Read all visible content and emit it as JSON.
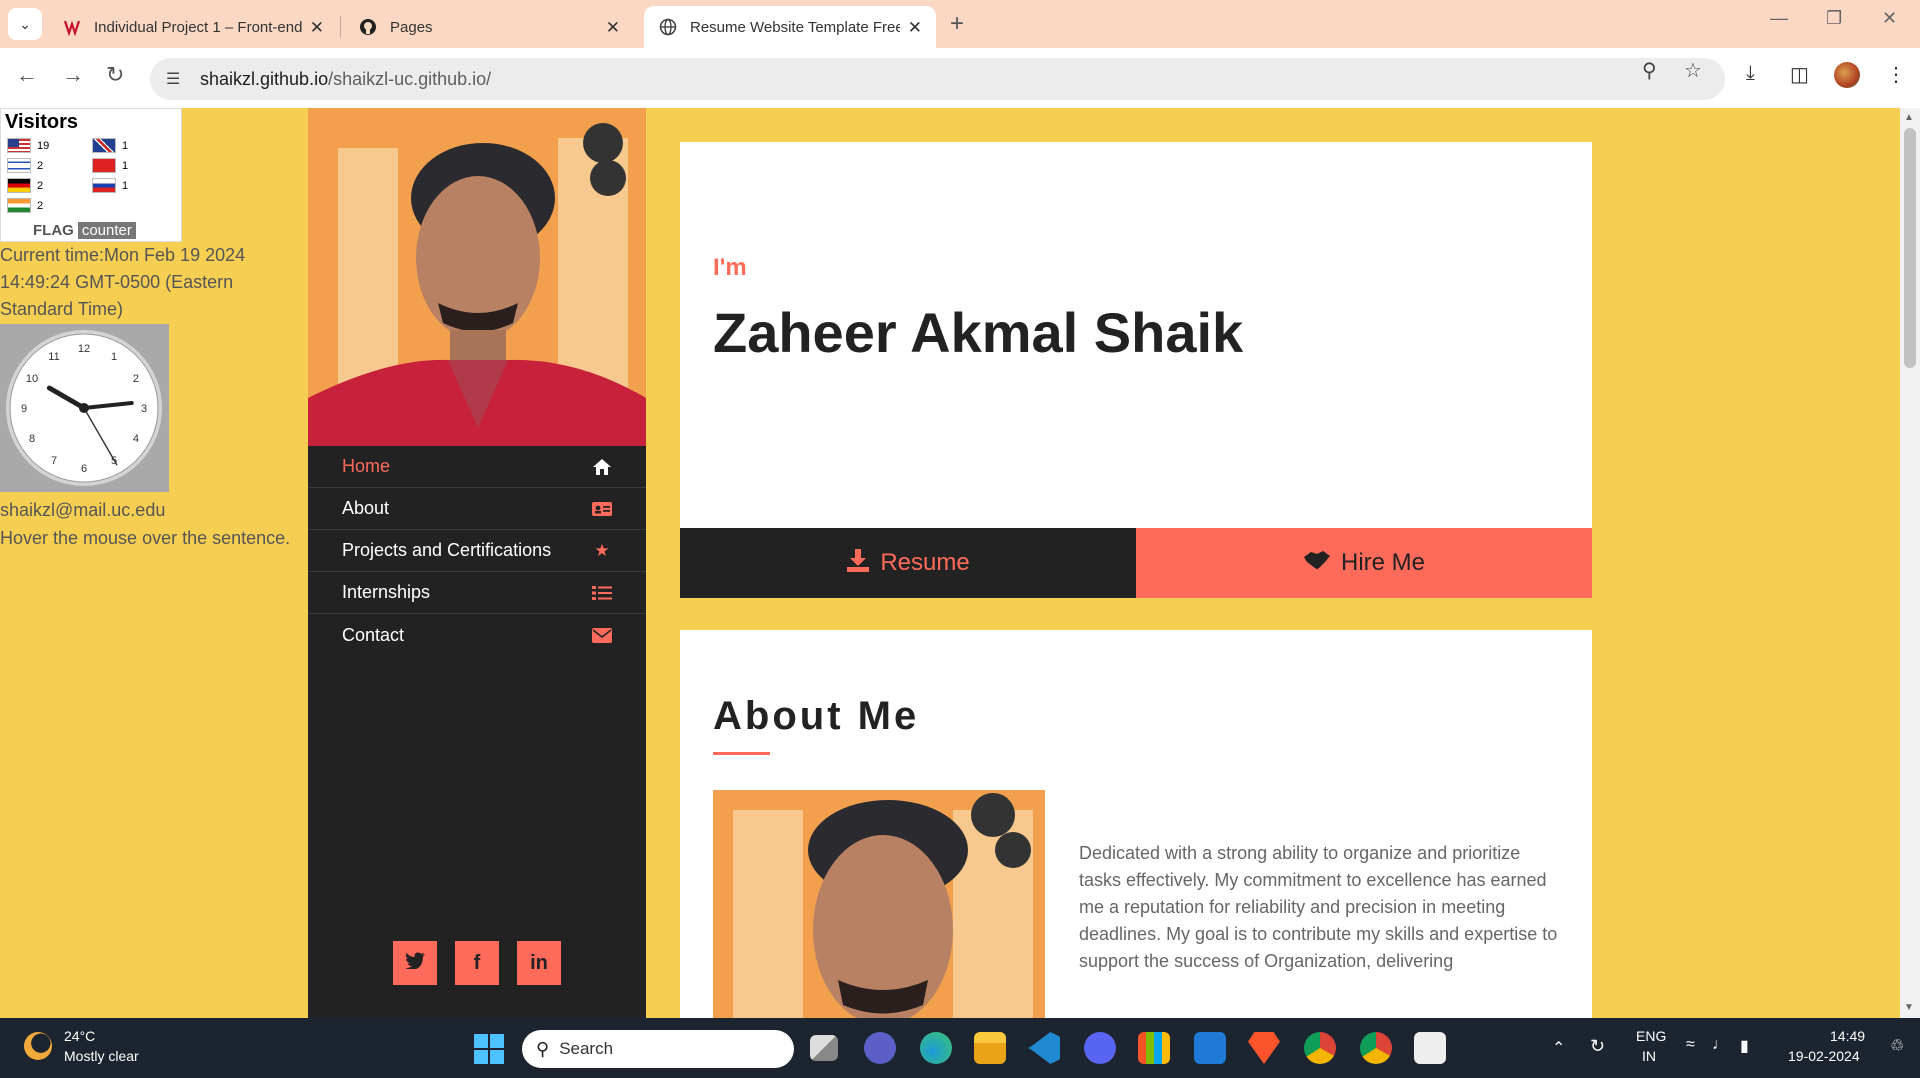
{
  "browser": {
    "tabs": [
      {
        "title": "Individual Project 1 – Front-end",
        "icon": "canvas-icon"
      },
      {
        "title": "Pages",
        "icon": "github-icon"
      },
      {
        "title": "Resume Website Template Free",
        "icon": "globe-icon"
      }
    ],
    "url_host": "shaikzl.github.io",
    "url_path": "/shaikzl-uc.github.io/"
  },
  "flag_counter": {
    "title": "Visitors",
    "rows": [
      {
        "country": "us",
        "count": "19"
      },
      {
        "country": "gb",
        "count": "1"
      },
      {
        "country": "il",
        "count": "2"
      },
      {
        "country": "hk",
        "count": "1"
      },
      {
        "country": "de",
        "count": "2"
      },
      {
        "country": "ru",
        "count": "1"
      },
      {
        "country": "in",
        "count": "2"
      }
    ],
    "logo_text": "FLAG",
    "logo_counter": "counter"
  },
  "sidebar_info": {
    "current_time": "Current time:Mon Feb 19 2024 14:49:24 GMT-0500 (Eastern Standard Time)",
    "clock_numbers": [
      "12",
      "1",
      "2",
      "3",
      "4",
      "5",
      "6",
      "7",
      "8",
      "9",
      "10",
      "11"
    ],
    "clock_time": {
      "hours": 2,
      "minutes": 49,
      "seconds": 24
    },
    "email": "shaikzl@mail.uc.edu",
    "hover_note": "Hover the mouse over the sentence."
  },
  "nav": {
    "items": [
      {
        "label": "Home",
        "icon": "home-icon",
        "active": true
      },
      {
        "label": "About",
        "icon": "id-card-icon"
      },
      {
        "label": "Projects and Certifications",
        "icon": "star-icon"
      },
      {
        "label": "Internships",
        "icon": "list-icon"
      },
      {
        "label": "Contact",
        "icon": "envelope-icon"
      }
    ],
    "social": [
      {
        "label": "twitter",
        "glyph": "t"
      },
      {
        "label": "facebook",
        "glyph": "f"
      },
      {
        "label": "linkedin",
        "glyph": "in"
      }
    ]
  },
  "hero": {
    "greeting": "I'm",
    "name": "Zaheer Akmal Shaik",
    "resume_label": "Resume",
    "hire_label": "Hire Me"
  },
  "about": {
    "title": "About Me",
    "text": "Dedicated with a strong ability to organize and prioritize tasks effectively. My commitment to excellence has earned me a reputation for reliability and precision in meeting deadlines. My goal is to contribute my skills and expertise to support the success of Organization, delivering"
  },
  "taskbar": {
    "temp": "24°C",
    "weather": "Mostly clear",
    "search_placeholder": "Search",
    "lang": "ENG",
    "region": "IN",
    "time": "14:49",
    "date": "19-02-2024"
  },
  "colors": {
    "page_bg": "#f6cf52",
    "accent": "#ff6b5b",
    "dark": "#222222"
  }
}
